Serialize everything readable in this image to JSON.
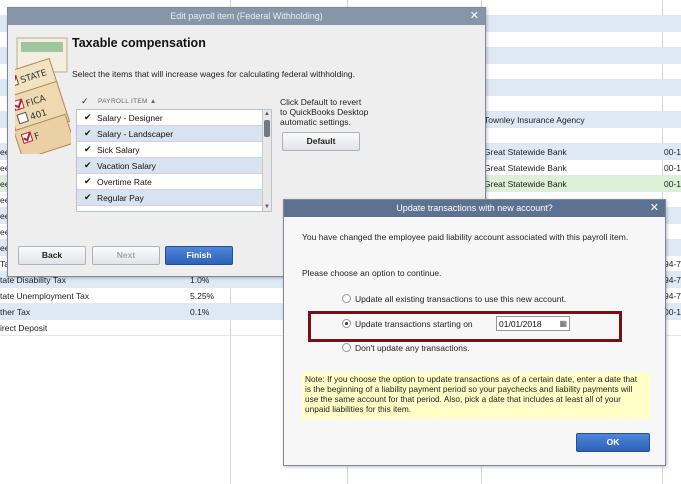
{
  "background_list": {
    "rows": [
      {
        "name": "",
        "rate": "",
        "agency": "",
        "number": ""
      },
      {
        "name": "",
        "rate": "",
        "agency": "",
        "number": ""
      },
      {
        "name": "",
        "rate": "",
        "agency": "",
        "number": ""
      },
      {
        "name": "",
        "rate": "",
        "agency": "",
        "number": ""
      },
      {
        "name": "",
        "rate": "",
        "agency": "",
        "number": ""
      },
      {
        "name": "",
        "rate": "",
        "agency": "",
        "number": ""
      },
      {
        "name": "",
        "rate": "",
        "agency": "",
        "number": ""
      },
      {
        "name": "",
        "rate": "",
        "agency": "Townley Insurance Agency",
        "number": ""
      },
      {
        "name": "",
        "rate": "",
        "agency": "",
        "number": ""
      },
      {
        "name": "ee",
        "rate": "",
        "agency": "Great Statewide Bank",
        "number": "00-1"
      },
      {
        "name": "ee",
        "rate": "",
        "agency": "Great Statewide Bank",
        "number": "00-1"
      },
      {
        "name": "ee",
        "rate": "",
        "agency": "Great Statewide Bank",
        "number": "00-1"
      },
      {
        "name": "ee",
        "rate": "",
        "agency": "",
        "number": ""
      },
      {
        "name": "ee",
        "rate": "",
        "agency": "",
        "number": ""
      },
      {
        "name": "ee",
        "rate": "",
        "agency": "",
        "number": ""
      },
      {
        "name": "ee",
        "rate": "",
        "agency": "",
        "number": ""
      },
      {
        "name": "Ta",
        "rate": "",
        "agency": "",
        "number": "94-7"
      },
      {
        "name": "tate Disability Tax",
        "rate": "1.0%",
        "agency": "",
        "number": "94-7"
      },
      {
        "name": "tate Unemployment Tax",
        "rate": "5.25%",
        "agency": "",
        "number": "94-7"
      },
      {
        "name": "ther Tax",
        "rate": "0.1%",
        "agency": "",
        "number": "00-1"
      },
      {
        "name": "irect Deposit",
        "rate": "",
        "agency": "",
        "number": ""
      }
    ]
  },
  "edit_window": {
    "title": "Edit payroll item (Federal Withholding)",
    "heading": "Taxable compensation",
    "instructions": "Select the items that will increase wages for calculating federal withholding.",
    "column_header": "PAYROLL ITEM",
    "check_header": "✓",
    "items": [
      {
        "checked": "✔",
        "label": "Salary - Designer"
      },
      {
        "checked": "✔",
        "label": "Salary - Landscaper"
      },
      {
        "checked": "✔",
        "label": "Sick Salary"
      },
      {
        "checked": "✔",
        "label": "Vacation Salary"
      },
      {
        "checked": "✔",
        "label": "Overtime Rate"
      },
      {
        "checked": "✔",
        "label": "Regular Pay"
      }
    ],
    "hint_lines": [
      "Click Default to revert",
      "to QuickBooks Desktop",
      "automatic settings."
    ],
    "default_label": "Default",
    "back_label": "Back",
    "next_label": "Next",
    "finish_label": "Finish"
  },
  "update_dialog": {
    "title": "Update transactions with new account?",
    "message": "You have changed the employee paid liability account associated with this payroll item.",
    "prompt": "Please choose an option to continue.",
    "option_all": "Update all existing transactions to use this new account.",
    "option_starting": "Update transactions starting on",
    "option_none": "Don't update any transactions.",
    "selected_option": "starting",
    "date_value": "01/01/2018",
    "note_lines": [
      "Note: If you choose the option to update transactions as of a certain date, enter a date that",
      "is the beginning of a liability payment period so your paychecks and liability payments will",
      "use the same account for that period. Also, pick a date that includes at least all of your",
      "unpaid liabilities for this item."
    ],
    "ok_label": "OK"
  },
  "colors": {
    "title_active": "#5d7190",
    "title_inactive": "#8795a8",
    "primary_button": "#2d62b8",
    "highlight_border": "#7b0e15",
    "note_background": "#ffffc7"
  }
}
